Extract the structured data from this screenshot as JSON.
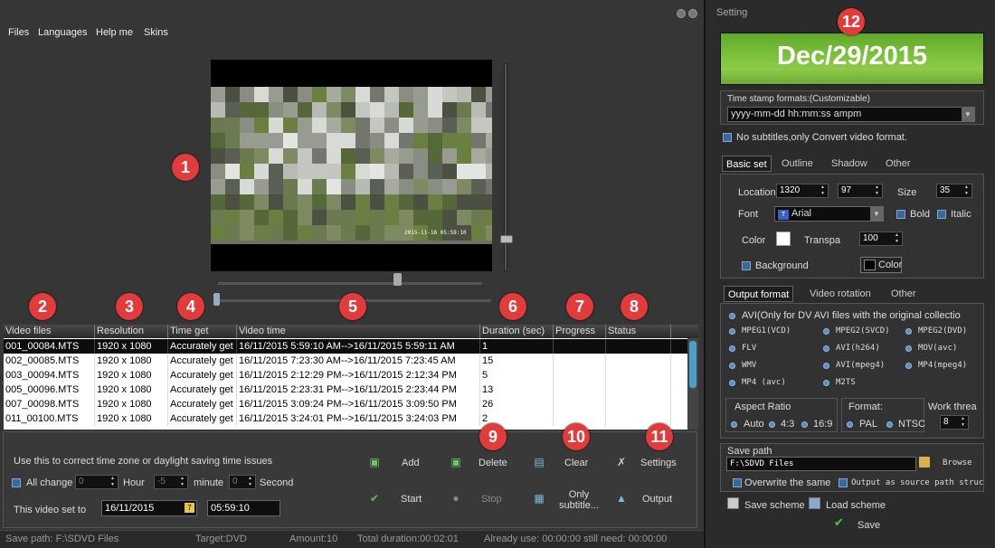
{
  "menu": [
    "Files",
    "Languages",
    "Help me",
    "Skins"
  ],
  "badges": [
    "1",
    "2",
    "3",
    "4",
    "5",
    "6",
    "7",
    "8",
    "9",
    "10",
    "11",
    "12"
  ],
  "video": {
    "overlay_time": "2015-11-16    05:59:10"
  },
  "table": {
    "columns": [
      "Video files",
      "Resolution",
      "Time get",
      "Video time",
      "Duration (sec)",
      "Progress",
      "Status"
    ],
    "rows": [
      {
        "file": "001_00084.MTS",
        "res": "1920 x 1080",
        "get": "Accurately get",
        "time": "16/11/2015 5:59:10 AM-->16/11/2015 5:59:11 AM",
        "dur": "1",
        "progress": "",
        "status": ""
      },
      {
        "file": "002_00085.MTS",
        "res": "1920 x 1080",
        "get": "Accurately get",
        "time": "16/11/2015 7:23:30 AM-->16/11/2015 7:23:45 AM",
        "dur": "15",
        "progress": "",
        "status": ""
      },
      {
        "file": "003_00094.MTS",
        "res": "1920 x 1080",
        "get": "Accurately get",
        "time": "16/11/2015 2:12:29 PM-->16/11/2015 2:12:34 PM",
        "dur": "5",
        "progress": "",
        "status": ""
      },
      {
        "file": "005_00096.MTS",
        "res": "1920 x 1080",
        "get": "Accurately get",
        "time": "16/11/2015 2:23:31 PM-->16/11/2015 2:23:44 PM",
        "dur": "13",
        "progress": "",
        "status": ""
      },
      {
        "file": "007_00098.MTS",
        "res": "1920 x 1080",
        "get": "Accurately get",
        "time": "16/11/2015 3:09:24 PM-->16/11/2015 3:09:50 PM",
        "dur": "26",
        "progress": "",
        "status": ""
      },
      {
        "file": "011_00100.MTS",
        "res": "1920 x 1080",
        "get": "Accurately get",
        "time": "16/11/2015 3:24:01 PM-->16/11/2015 3:24:03 PM",
        "dur": "2",
        "progress": "",
        "status": ""
      }
    ]
  },
  "correction": {
    "hint": "Use this to correct time zone or daylight saving time issues",
    "all_change": "All change",
    "hour_value": "0",
    "hour_label": "Hour",
    "minute_value": "-5",
    "minute_label": "minute",
    "second_value": "0",
    "second_label": "Second",
    "set_to_label": "This video set to",
    "date_value": "16/11/2015",
    "time_value": "05:59:10"
  },
  "actions": {
    "add": "Add",
    "delete": "Delete",
    "clear": "Clear",
    "settings": "Settings",
    "start": "Start",
    "stop": "Stop",
    "only_subtitle": "Only subtitle...",
    "output": "Output"
  },
  "status": {
    "save_path": "Save path:  F:\\SDVD Files",
    "target": "Target:DVD",
    "amount": "Amount:10",
    "total": "Total duration:00:02:01",
    "already": "Already use: 00:00:00 still need: 00:00:00"
  },
  "setting": {
    "title": "Setting",
    "banner_date": "Dec/29/2015",
    "stamp_label": "Time stamp formats:(Customizable)",
    "stamp_value": "yyyy-mm-dd     hh:mm:ss ampm",
    "no_subtitles": "No subtitles,only Convert video format.",
    "tabs1": [
      "Basic set",
      "Outline",
      "Shadow",
      "Other"
    ],
    "location_label": "Location",
    "loc_x": "1320",
    "loc_y": "97",
    "size_label": "Size",
    "size_value": "35",
    "font_label": "Font",
    "font_value": "Arial",
    "bold": "Bold",
    "italic": "Italic",
    "color_label": "Color",
    "transpa_label": "Transpa",
    "transpa_value": "100",
    "background_label": "Background",
    "color_button": "Color",
    "text_color": "#ffffff",
    "bg_color": "#000000",
    "tabs2": [
      "Output format",
      "Video rotation",
      "Other"
    ],
    "avi_note": "AVI(Only for DV AVI files with the original collectio",
    "formats": [
      "MPEG1(VCD)",
      "MPEG2(SVCD)",
      "MPEG2(DVD)",
      "FLV",
      "AVI(h264)",
      "MOV(avc)",
      "WMV",
      "AVI(mpeg4)",
      "MP4(mpeg4)",
      "MP4 (avc)",
      "M2TS"
    ],
    "aspect_label": "Aspect Ratio",
    "aspect_opts": [
      "Auto",
      "4:3",
      "16:9"
    ],
    "format_label": "Format:",
    "format_opts": [
      "PAL",
      "NTSC"
    ],
    "work_label": "Work threa",
    "work_value": "8",
    "save_path_label": "Save path",
    "save_path_value": "F:\\SDVD Files",
    "browse": "Browse",
    "overwrite": "Overwrite the same",
    "output_as_source": "Output as source path struc",
    "save_scheme": "Save scheme",
    "load_scheme": "Load scheme",
    "save": "Save"
  }
}
